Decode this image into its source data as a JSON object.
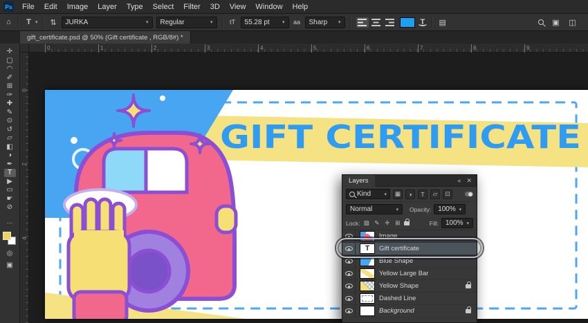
{
  "app": {
    "logo": "Ps"
  },
  "menu": {
    "items": [
      "File",
      "Edit",
      "Image",
      "Layer",
      "Type",
      "Select",
      "Filter",
      "3D",
      "View",
      "Window",
      "Help"
    ]
  },
  "options": {
    "home_glyph": "⌂",
    "tool_glyph": "T",
    "caret": "▾",
    "orientation_glyph": "⇅",
    "font_family": "JURKA",
    "font_style": "Regular",
    "size_icon": "tT",
    "font_size": "55.28 pt",
    "aa_icon": "aa",
    "anti_alias": "Sharp",
    "color_hex": "#1ba1f2",
    "warp_glyph": "T",
    "panels_glyph": "▤",
    "workspace_glyph": "▣",
    "arrange_glyph": "◫"
  },
  "tab": {
    "title": "gift_certificate.psd @ 50% (Gift certificate , RGB/8#) *"
  },
  "tools": [
    {
      "name": "move",
      "glyph": "✛"
    },
    {
      "name": "rectangular-marquee",
      "glyph": "▢"
    },
    {
      "name": "lasso",
      "glyph": "◠"
    },
    {
      "name": "quick-selection",
      "glyph": "✐"
    },
    {
      "name": "crop",
      "glyph": "⊞"
    },
    {
      "name": "eyedropper",
      "glyph": "✑"
    },
    {
      "name": "healing-brush",
      "glyph": "✚"
    },
    {
      "name": "brush",
      "glyph": "✎"
    },
    {
      "name": "clone-stamp",
      "glyph": "⊙"
    },
    {
      "name": "history-brush",
      "glyph": "↺"
    },
    {
      "name": "eraser",
      "glyph": "▱"
    },
    {
      "name": "gradient",
      "glyph": "◧"
    },
    {
      "name": "blur",
      "glyph": "◑"
    },
    {
      "name": "pen",
      "glyph": "✒"
    },
    {
      "name": "type",
      "glyph": "T",
      "active": true
    },
    {
      "name": "path-selection",
      "glyph": "▶"
    },
    {
      "name": "rectangle",
      "glyph": "▭"
    },
    {
      "name": "hand",
      "glyph": "☛"
    },
    {
      "name": "zoom",
      "glyph": "⊘"
    }
  ],
  "toolbar_footer": {
    "more_glyph": "⋯",
    "foreground_hex": "#f1d158",
    "background_hex": "#ffffff",
    "quick_mask_glyph": "◎",
    "screen_mode_glyph": "▣"
  },
  "rulers": {
    "horizontal": [
      "0",
      "1",
      "2",
      "3",
      "4",
      "5",
      "6",
      "7",
      "8",
      "9"
    ],
    "vertical": [
      "0",
      "2",
      "4"
    ]
  },
  "canvas": {
    "headline": "GIFT CERTIFICATE",
    "colors": {
      "blue": "#47a5f2",
      "headline": "#2f9bf1",
      "yellow": "#f4e283",
      "glove": "#f6df74",
      "pink": "#f2688d",
      "outline": "#8c4fd4",
      "wheel_outer": "#a181e0",
      "wheel_inner": "#7b51c9",
      "window": "#8ed8f8",
      "dash": "#4aa7f3"
    }
  },
  "layers_panel": {
    "title": "Layers",
    "collapse_glyph": "«",
    "close_glyph": "✕",
    "filter_label": "Kind",
    "filter_icons": [
      {
        "name": "pixel",
        "glyph": "▦"
      },
      {
        "name": "adjustment",
        "glyph": "◑"
      },
      {
        "name": "type",
        "glyph": "T"
      },
      {
        "name": "shape",
        "glyph": "▱"
      },
      {
        "name": "smart-object",
        "glyph": "⊡"
      }
    ],
    "blend_mode": "Normal",
    "opacity_label": "Opacity:",
    "opacity_value": "100%",
    "lock_label": "Lock:",
    "lock_icons": [
      {
        "name": "lock-transparency",
        "glyph": "▨"
      },
      {
        "name": "lock-pixels",
        "glyph": "✎"
      },
      {
        "name": "lock-position",
        "glyph": "✛"
      },
      {
        "name": "lock-artboard",
        "glyph": "⊞"
      }
    ],
    "fill_label": "Fill:",
    "fill_value": "100%",
    "layers": [
      {
        "name": "Image"
      },
      {
        "name": "Gift certificate",
        "thumb_glyph": "T",
        "selected": true
      },
      {
        "name": "Blue Shape"
      },
      {
        "name": "Yellow Large Bar"
      },
      {
        "name": "Yellow Shape",
        "locked": true
      },
      {
        "name": "Dashed Line"
      },
      {
        "name": "Background",
        "locked": true
      }
    ]
  }
}
